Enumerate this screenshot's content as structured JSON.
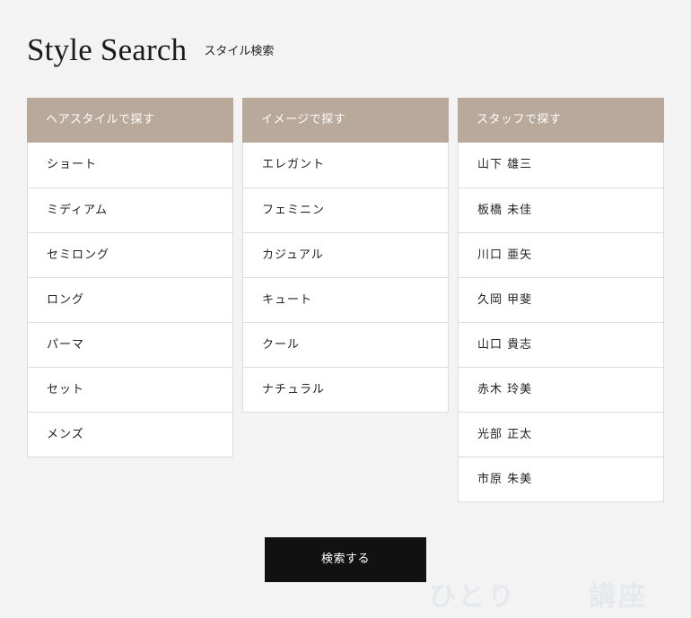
{
  "header": {
    "title": "Style Search",
    "subtitle": "スタイル検索"
  },
  "columns": [
    {
      "title": "ヘアスタイルで探す",
      "items": [
        "ショート",
        "ミディアム",
        "セミロング",
        "ロング",
        "パーマ",
        "セット",
        "メンズ"
      ]
    },
    {
      "title": "イメージで探す",
      "items": [
        "エレガント",
        "フェミニン",
        "カジュアル",
        "キュート",
        "クール",
        "ナチュラル"
      ]
    },
    {
      "title": "スタッフで探す",
      "items": [
        "山下 雄三",
        "板橋 未佳",
        "川口 亜矢",
        "久岡 甲斐",
        "山口 貴志",
        "赤木 玲美",
        "光部 正太",
        "市原 朱美"
      ]
    }
  ],
  "search_button": {
    "label": "検索する"
  },
  "watermark": {
    "left": "ひとり",
    "right": "講座"
  },
  "colors": {
    "background": "#f3f3f3",
    "header_bg": "#b8a99a",
    "button_bg": "#111111"
  }
}
